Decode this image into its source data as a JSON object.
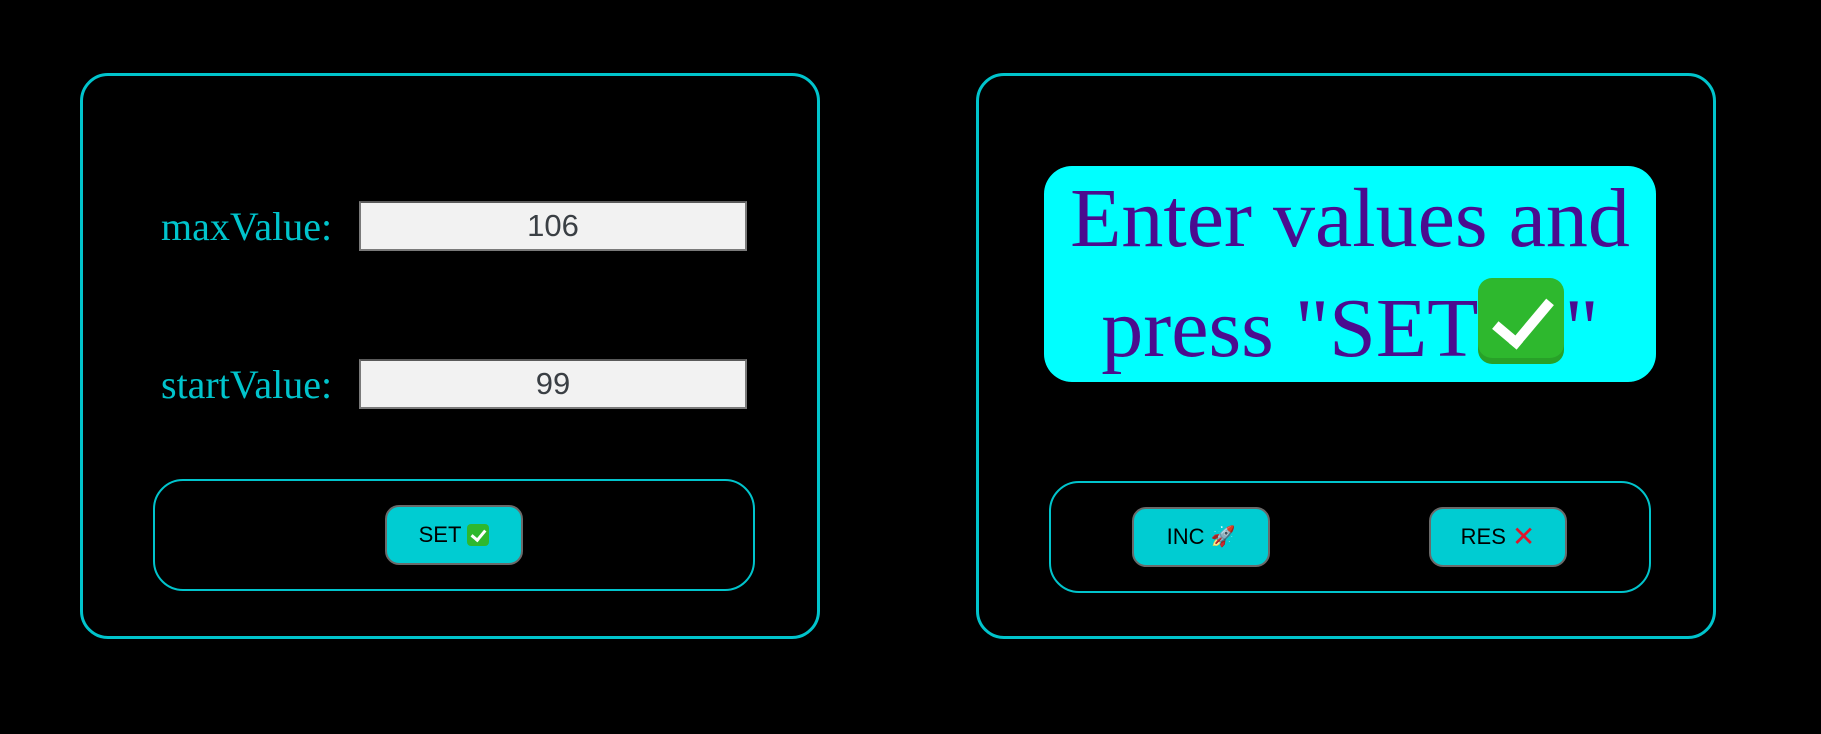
{
  "settings_panel": {
    "max_label": "maxValue:",
    "max_value": "106",
    "start_label": "startValue:",
    "start_value": "99",
    "set_button_label": "SET"
  },
  "counter_panel": {
    "message_line1": "Enter values and",
    "message_line2_prefix": "press \"SET",
    "message_line2_suffix": "\"",
    "inc_button_label": "INC",
    "res_button_label": "RES"
  },
  "icons": {
    "set": "check-mark-icon",
    "inc": "rocket-icon",
    "res": "cross-mark-icon",
    "message": "check-mark-icon"
  },
  "colors": {
    "background": "#000000",
    "accent": "#00c4cc",
    "button": "#00ccd2",
    "message_background": "#00ffff",
    "message_text": "#4b0c8f"
  }
}
